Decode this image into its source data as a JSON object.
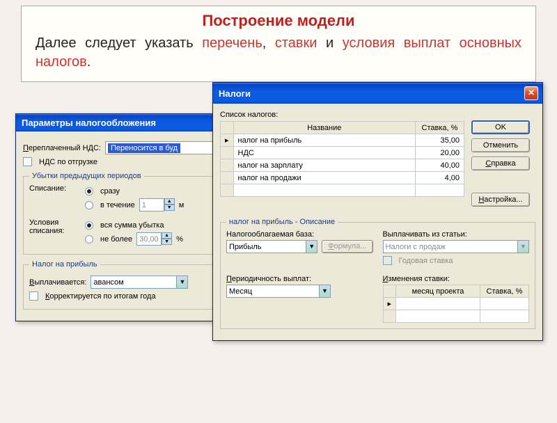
{
  "header": {
    "title": "Построение модели",
    "text_prefix": "Далее следует указать ",
    "w1": "перечень",
    "sep1": ", ",
    "w2": "ставки",
    "mid": " и ",
    "w3": "условия выплат основных налогов",
    "suffix": "."
  },
  "win1": {
    "title": "Параметры налогообложения",
    "vat_label_u": "П",
    "vat_label_rest": "ереплаченный НДС:",
    "vat_value": "Переносится в буд",
    "vat_ship": "НДС по отгрузке",
    "losses_legend": "Убытки предыдущих периодов",
    "writeoff_label": "Списание:",
    "opt_immediate": "сразу",
    "opt_during": "в течение",
    "during_val": "1",
    "during_unit": "м",
    "cond_label": "Условия списания:",
    "opt_full": "вся сумма убытка",
    "opt_notmore": "не более",
    "notmore_val": "30,00",
    "notmore_unit": "%",
    "profit_legend": "Налог на прибыль",
    "paid_label_u": "В",
    "paid_label_rest": "ыплачивается:",
    "paid_value": "авансом",
    "corr_u": "К",
    "corr_rest": "орректируется по итогам года"
  },
  "win2": {
    "title": "Налоги",
    "list_label": "Список налогов:",
    "col_name": "Название",
    "col_rate": "Ставка, %",
    "rows": [
      {
        "name": "налог на прибыль",
        "rate": "35,00"
      },
      {
        "name": "НДС",
        "rate": "20,00"
      },
      {
        "name": "налог на зарплату",
        "rate": "40,00"
      },
      {
        "name": "налог на продажи",
        "rate": "4,00"
      }
    ],
    "btn_ok": "OK",
    "btn_cancel": "Отменить",
    "btn_help_u": "С",
    "btn_help_rest": "правка",
    "btn_settings_u": "Н",
    "btn_settings_rest": "астройка...",
    "desc_legend": "налог на прибыль - Описание",
    "base_label": "Налогооблагаемая база:",
    "base_value": "Прибыль",
    "formula_u": "Ф",
    "formula_rest": "ормула...",
    "payfrom_label": "Выплачивать из статьи:",
    "payfrom_value": "Налоги с продаж",
    "annual": "Годовая ставка",
    "period_label_u": "П",
    "period_label_rest": "ериодичность выплат:",
    "period_value": "Месяц",
    "changes_label_u": "И",
    "changes_label_rest": "зменения ставки:",
    "col_month": "месяц проекта",
    "col_rate2": "Ставка, %"
  }
}
